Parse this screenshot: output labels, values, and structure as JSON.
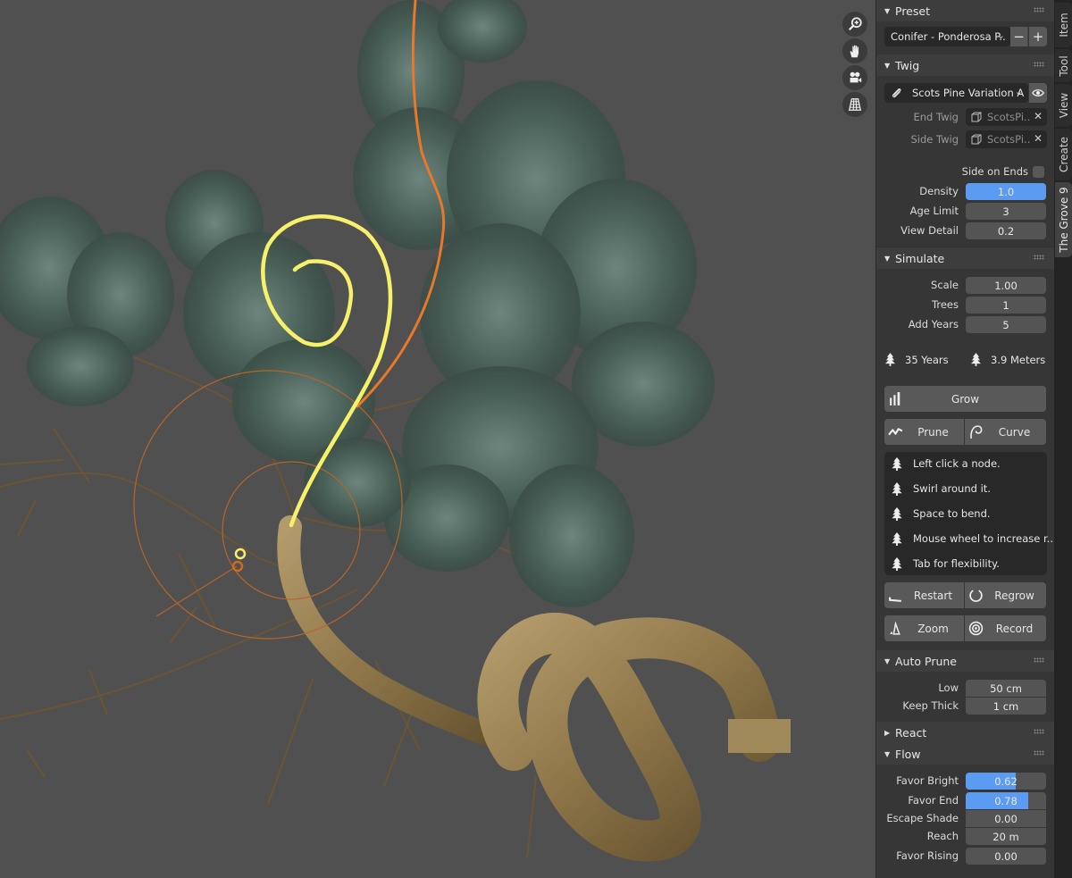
{
  "viewport": {
    "background": "#505050",
    "nav_buttons": [
      {
        "name": "zoom-view-icon"
      },
      {
        "name": "pan-hand-icon"
      },
      {
        "name": "camera-icon"
      },
      {
        "name": "grid-perspective-icon"
      }
    ],
    "curves": {
      "swirl_color": "#f7f06a",
      "path_color": "#e8782a",
      "brush_circle_color": "#b5652b"
    }
  },
  "tabs": [
    {
      "label": "Item",
      "active": false
    },
    {
      "label": "Tool",
      "active": false
    },
    {
      "label": "View",
      "active": false
    },
    {
      "label": "Create",
      "active": false
    },
    {
      "label": "The Grove 9",
      "active": true
    }
  ],
  "preset": {
    "title": "Preset",
    "selected": "Conifer - Ponderosa P..",
    "remove_label": "−",
    "add_label": "+"
  },
  "twig": {
    "title": "Twig",
    "selected": "Scots Pine Variation A",
    "end_twig_label": "End Twig",
    "end_twig_value": "ScotsPi..",
    "side_twig_label": "Side Twig",
    "side_twig_value": "ScotsPi..",
    "side_on_ends_label": "Side on Ends",
    "side_on_ends_checked": false,
    "density_label": "Density",
    "density_value": "1.0",
    "age_limit_label": "Age Limit",
    "age_limit_value": "3",
    "view_detail_label": "View Detail",
    "view_detail_value": "0.2"
  },
  "simulate": {
    "title": "Simulate",
    "scale_label": "Scale",
    "scale_value": "1.00",
    "trees_label": "Trees",
    "trees_value": "1",
    "add_years_label": "Add Years",
    "add_years_value": "5",
    "age_stat": "35 Years",
    "height_stat": "3.9 Meters",
    "grow_label": "Grow",
    "prune_label": "Prune",
    "curve_label": "Curve",
    "tips": [
      "Left click a node.",
      "Swirl around it.",
      "Space to bend.",
      "Mouse wheel to increase r..",
      "Tab for flexibility."
    ],
    "restart_label": "Restart",
    "regrow_label": "Regrow",
    "zoom_label": "Zoom",
    "record_label": "Record"
  },
  "auto_prune": {
    "title": "Auto Prune",
    "low_label": "Low",
    "low_value": "50 cm",
    "keep_thick_label": "Keep Thick",
    "keep_thick_value": "1 cm"
  },
  "react": {
    "title": "React",
    "collapsed": true
  },
  "flow": {
    "title": "Flow",
    "favor_bright_label": "Favor Bright",
    "favor_bright_value": "0.62",
    "favor_bright_fraction": 0.62,
    "favor_end_label": "Favor End",
    "favor_end_value": "0.78",
    "favor_end_fraction": 0.78,
    "escape_shade_label": "Escape Shade",
    "escape_shade_value": "0.00",
    "reach_label": "Reach",
    "reach_value": "20 m",
    "favor_rising_label": "Favor Rising",
    "favor_rising_value": "0.00"
  },
  "colors": {
    "accent": "#5c9bf2",
    "panel_bg": "#363636",
    "header_bg": "#3d3d3d",
    "field_bg": "#545454"
  }
}
